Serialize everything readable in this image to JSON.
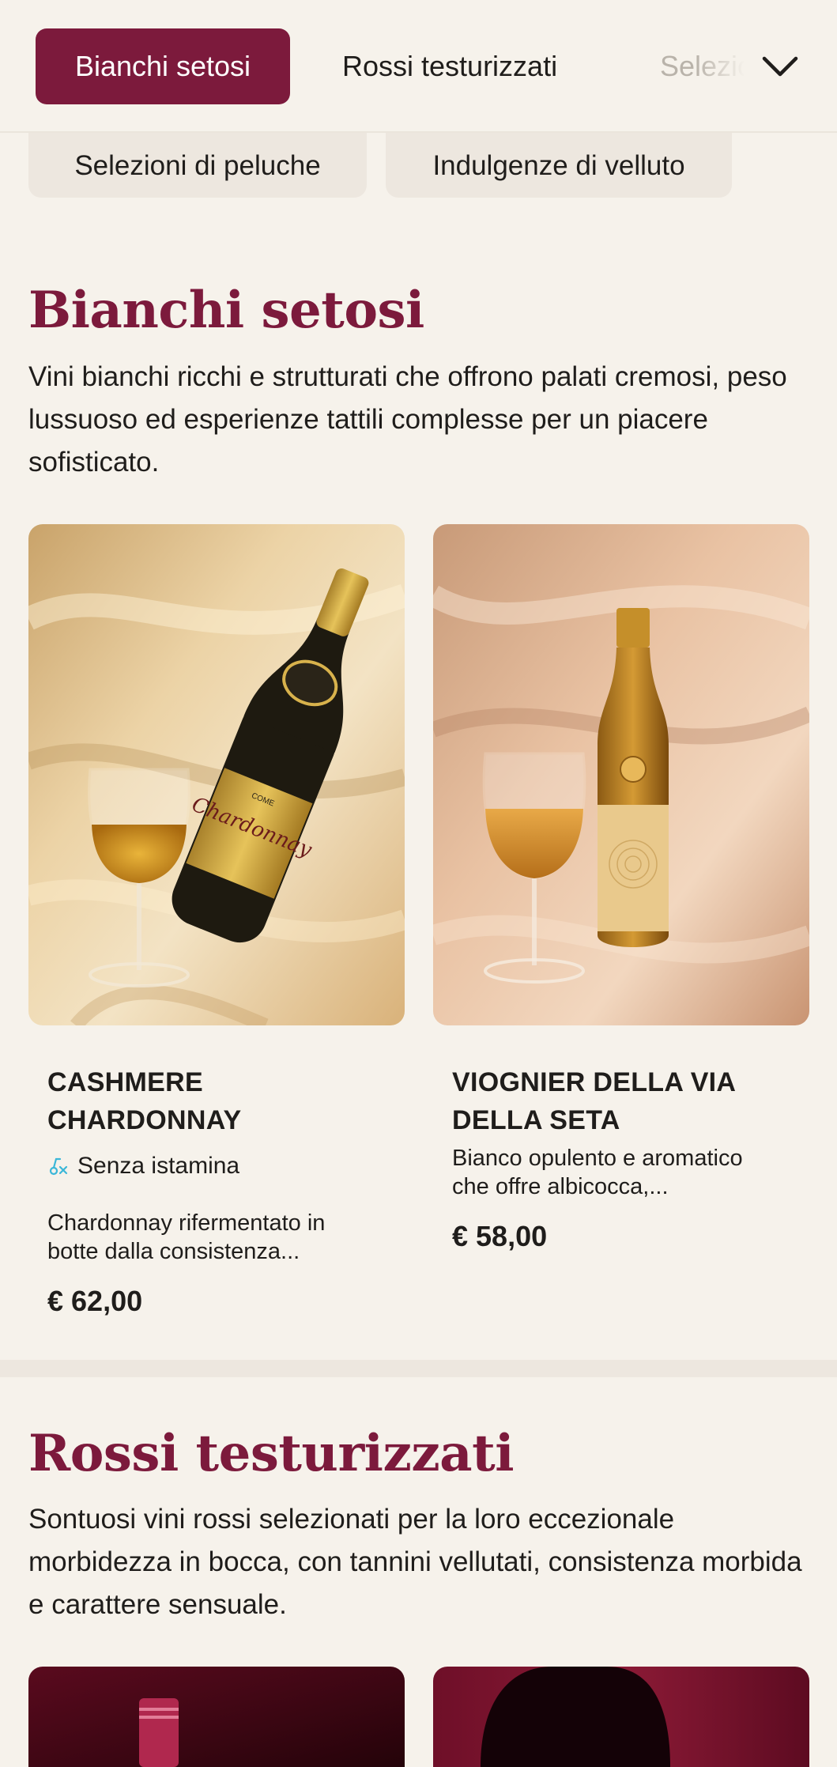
{
  "tabs": {
    "active": "Bianchi setosi",
    "second": "Rossi testurizzati",
    "third": "Selezioni di peluche",
    "expand_icon": "chevron-down-icon"
  },
  "chips": [
    "Selezioni di peluche",
    "Indulgenze di velluto"
  ],
  "sections": [
    {
      "title": "Bianchi setosi",
      "description": "Vini bianchi ricchi e strutturati che offrono palati cremosi, peso lussuoso ed esperienze tattili complesse per un piacere sofisticato.",
      "products": [
        {
          "name": "CASHMERE CHARDONNAY",
          "badge": "Senza istamina",
          "badge_icon": "histamine-free-icon",
          "description": "Chardonnay rifermentato in botte dalla consistenza...",
          "price": "€ 62,00",
          "bottle_label": "Chardonnay",
          "bottle_brand": "COME"
        },
        {
          "name": "VIOGNIER DELLA VIA DELLA SETA",
          "description": "Bianco opulento e aromatico che offre albicocca,...",
          "price": "€ 58,00"
        }
      ]
    },
    {
      "title": "Rossi testurizzati",
      "description": "Sontuosi vini rossi selezionati per la loro eccezionale morbidezza in bocca, con tannini vellutati, consistenza morbida e carattere sensuale."
    }
  ],
  "colors": {
    "accent": "#7c1a3c",
    "background": "#f6f2eb",
    "chip": "#ede7df",
    "badge_icon": "#3bb7d8"
  }
}
